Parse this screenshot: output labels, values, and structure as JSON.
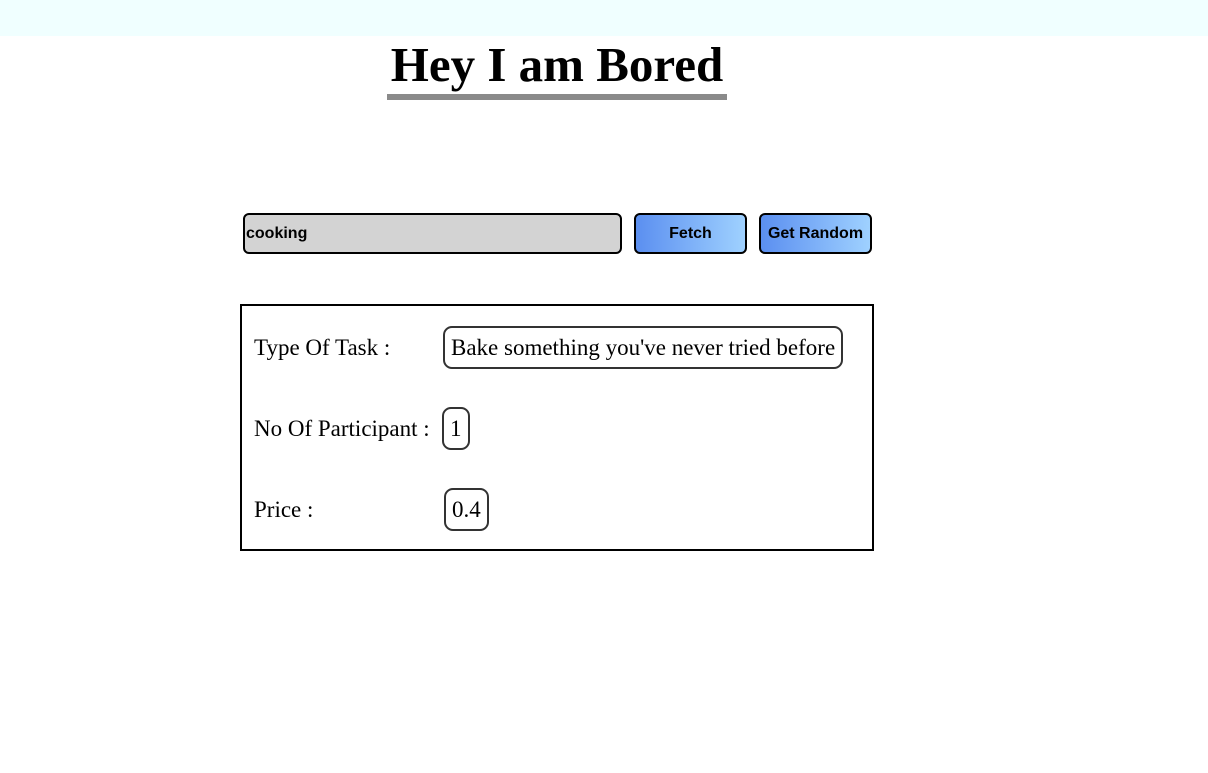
{
  "header": {
    "title": "Hey I am Bored"
  },
  "search": {
    "value": "cooking"
  },
  "buttons": {
    "fetch_label": "Fetch",
    "random_label": "Get Random"
  },
  "result": {
    "type_label": "Type Of Task :",
    "type_value": "Bake something you've never tried before",
    "participants_label": "No Of Participant :",
    "participants_value": "1",
    "price_label": "Price :",
    "price_value": "0.4"
  },
  "colors": {
    "top_bar": "#f0ffff",
    "input_background": "#d3d3d3",
    "button_gradient_start": "#5b8ff0",
    "button_gradient_end": "#9fd1ff",
    "title_underline": "#8a8a8a"
  }
}
